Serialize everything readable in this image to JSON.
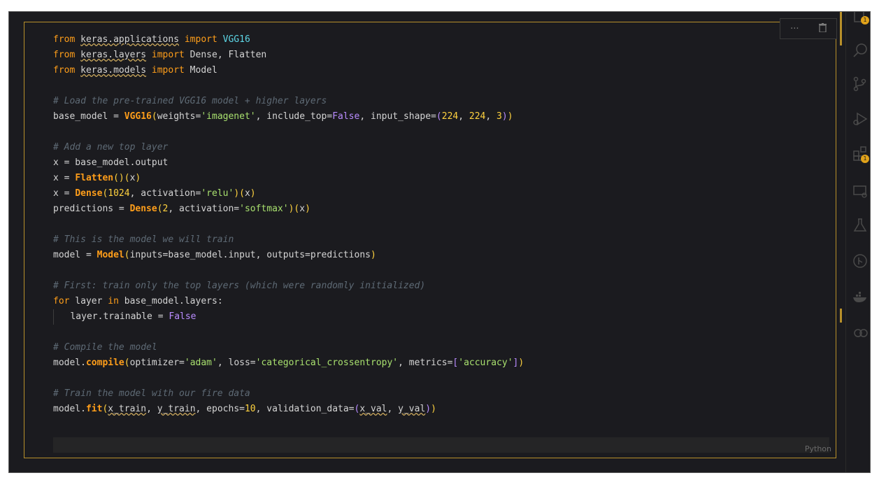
{
  "editor": {
    "language": "Python",
    "toolbar": {
      "more_label": "···",
      "delete_label": "🗑"
    },
    "lines": [
      "from keras.applications import VGG16",
      "from keras.layers import Dense, Flatten",
      "from keras.models import Model",
      "",
      "# Load the pre-trained VGG16 model + higher layers",
      "base_model = VGG16(weights='imagenet', include_top=False, input_shape=(224, 224, 3))",
      "",
      "# Add a new top layer",
      "x = base_model.output",
      "x = Flatten()(x)",
      "x = Dense(1024, activation='relu')(x)",
      "predictions = Dense(2, activation='softmax')(x)",
      "",
      "# This is the model we will train",
      "model = Model(inputs=base_model.input, outputs=predictions)",
      "",
      "# First: train only the top layers (which were randomly initialized)",
      "for layer in base_model.layers:",
      "    layer.trainable = False",
      "",
      "# Compile the model",
      "model.compile(optimizer='adam', loss='categorical_crossentropy', metrics=['accuracy'])",
      "",
      "# Train the model with our fire data",
      "model.fit(x_train, y_train, epochs=10, validation_data=(x_val, y_val))"
    ]
  },
  "activity_bar": {
    "items": [
      {
        "icon": "explorer-icon",
        "badge": "1"
      },
      {
        "icon": "search-icon"
      },
      {
        "icon": "source-control-icon"
      },
      {
        "icon": "run-debug-icon"
      },
      {
        "icon": "extensions-icon",
        "badge": "1"
      },
      {
        "icon": "remote-explorer-icon"
      },
      {
        "icon": "testing-icon"
      },
      {
        "icon": "git-graph-icon"
      },
      {
        "icon": "docker-icon"
      },
      {
        "icon": "copilot-icon"
      }
    ]
  },
  "colors": {
    "background": "#1b1b1f",
    "cell_border": "#b8902a",
    "keyword": "#ff9e1a",
    "string": "#a8e06e",
    "number": "#ffd23f",
    "comment": "#5e6a75"
  }
}
